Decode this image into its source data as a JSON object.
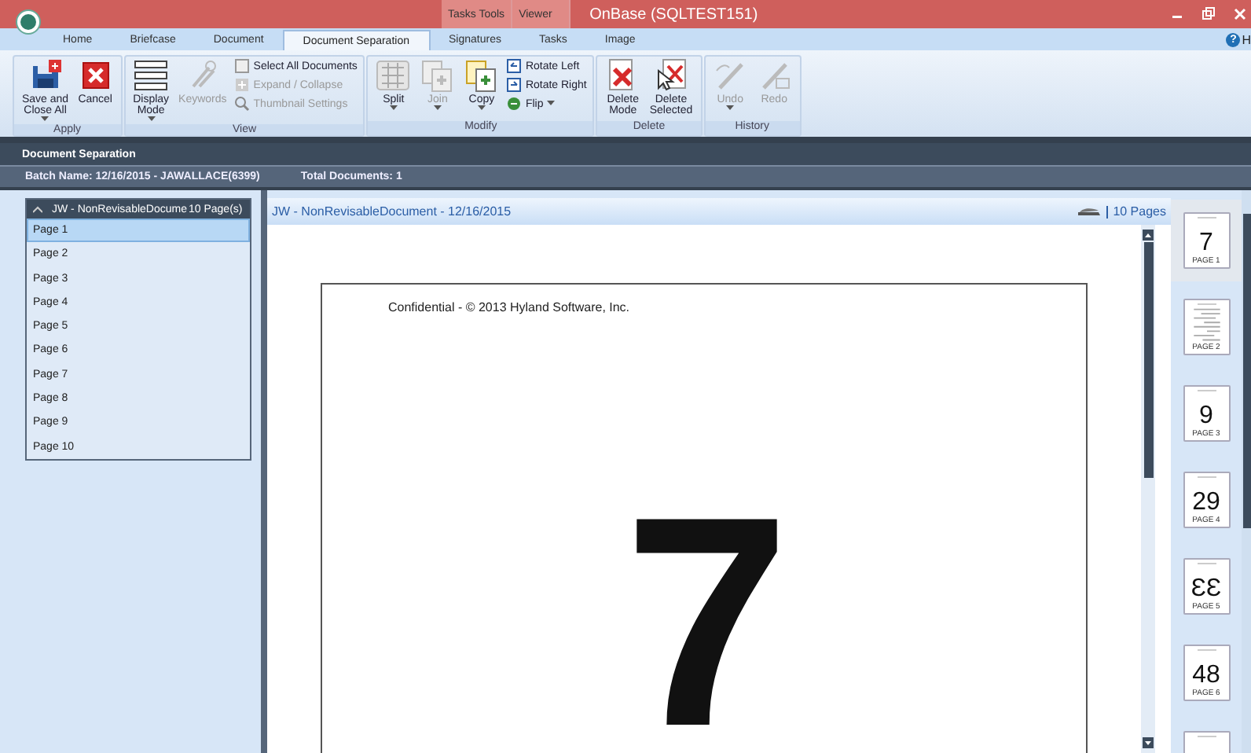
{
  "window": {
    "title": "OnBase (SQLTEST151)",
    "context_tabs": [
      {
        "label": "Tasks Tools"
      },
      {
        "label": "Viewer"
      }
    ]
  },
  "ribbon_tabs": [
    {
      "label": "Home",
      "selected": false
    },
    {
      "label": "Briefcase",
      "selected": false
    },
    {
      "label": "Document",
      "selected": false
    },
    {
      "label": "Document Separation",
      "selected": true
    },
    {
      "label": "Signatures",
      "selected": false
    },
    {
      "label": "Tasks",
      "selected": false
    },
    {
      "label": "Image",
      "selected": false
    }
  ],
  "help": {
    "icon": "?",
    "label": "H"
  },
  "ribbon_groups": [
    {
      "label": "Apply",
      "items": [
        {
          "kind": "large",
          "label": "Save and\nClose All",
          "dropdown": true,
          "disabled": false
        },
        {
          "kind": "large",
          "label": "Cancel",
          "dropdown": false,
          "disabled": false
        }
      ]
    },
    {
      "label": "View",
      "items": [
        {
          "kind": "large",
          "label": "Display\nMode",
          "dropdown": true,
          "disabled": false
        },
        {
          "kind": "large",
          "label": "Keywords",
          "dropdown": false,
          "disabled": true
        },
        {
          "kind": "small",
          "label": "Select All Documents",
          "dropdown": false,
          "disabled": false
        },
        {
          "kind": "small",
          "label": "Expand / Collapse",
          "dropdown": false,
          "disabled": true
        },
        {
          "kind": "small",
          "label": "Thumbnail Settings",
          "dropdown": false,
          "disabled": true
        }
      ]
    },
    {
      "label": "Modify",
      "items": [
        {
          "kind": "large",
          "label": "Split",
          "dropdown": true,
          "disabled": false
        },
        {
          "kind": "large",
          "label": "Join",
          "dropdown": true,
          "disabled": true
        },
        {
          "kind": "large",
          "label": "Copy",
          "dropdown": true,
          "disabled": false
        },
        {
          "kind": "small",
          "label": "Rotate Left",
          "dropdown": false,
          "disabled": false
        },
        {
          "kind": "small",
          "label": "Rotate Right",
          "dropdown": false,
          "disabled": false
        },
        {
          "kind": "small",
          "label": "Flip",
          "dropdown": true,
          "disabled": false
        }
      ]
    },
    {
      "label": "Delete",
      "items": [
        {
          "kind": "large",
          "label": "Delete\nMode",
          "dropdown": false,
          "disabled": false
        },
        {
          "kind": "large",
          "label": "Delete\nSelected",
          "dropdown": false,
          "disabled": false
        }
      ]
    },
    {
      "label": "History",
      "items": [
        {
          "kind": "large",
          "label": "Undo",
          "dropdown": true,
          "disabled": true
        },
        {
          "kind": "large",
          "label": "Redo",
          "dropdown": false,
          "disabled": true
        }
      ]
    }
  ],
  "panel_title": "Document Separation",
  "batch_bar": {
    "batch_name": "Batch Name: 12/16/2015 - JAWALLACE(6399)",
    "total": "Total Documents: 1"
  },
  "document_tree": {
    "title": "JW - NonRevisableDocume",
    "count": "10 Page(s)",
    "expanded": true,
    "pages": [
      {
        "label": "Page 1",
        "selected": true
      },
      {
        "label": "Page 2",
        "selected": false
      },
      {
        "label": "Page 3",
        "selected": false
      },
      {
        "label": "Page 4",
        "selected": false
      },
      {
        "label": "Page 5",
        "selected": false
      },
      {
        "label": "Page 6",
        "selected": false
      },
      {
        "label": "Page 7",
        "selected": false
      },
      {
        "label": "Page 8",
        "selected": false
      },
      {
        "label": "Page 9",
        "selected": false
      },
      {
        "label": "Page 10",
        "selected": false
      }
    ]
  },
  "viewer": {
    "title": "JW - NonRevisableDocument - 12/16/2015",
    "page_count": "10 Pages",
    "page_header": "Confidential - © 2013 Hyland Software, Inc.",
    "page_number": "7"
  },
  "thumbnails": [
    {
      "kind": "number",
      "number": "7",
      "label": "PAGE 1",
      "selected": true
    },
    {
      "kind": "text",
      "label": "PAGE 2",
      "selected": false
    },
    {
      "kind": "number",
      "number": "9",
      "label": "PAGE 3",
      "selected": false
    },
    {
      "kind": "number",
      "number": "29",
      "label": "PAGE 4",
      "selected": false
    },
    {
      "kind": "number",
      "number": "ƐƐ",
      "label": "PAGE 5",
      "selected": false
    },
    {
      "kind": "number",
      "number": "48",
      "label": "PAGE 6",
      "selected": false
    },
    {
      "kind": "blank",
      "selected": false
    }
  ]
}
